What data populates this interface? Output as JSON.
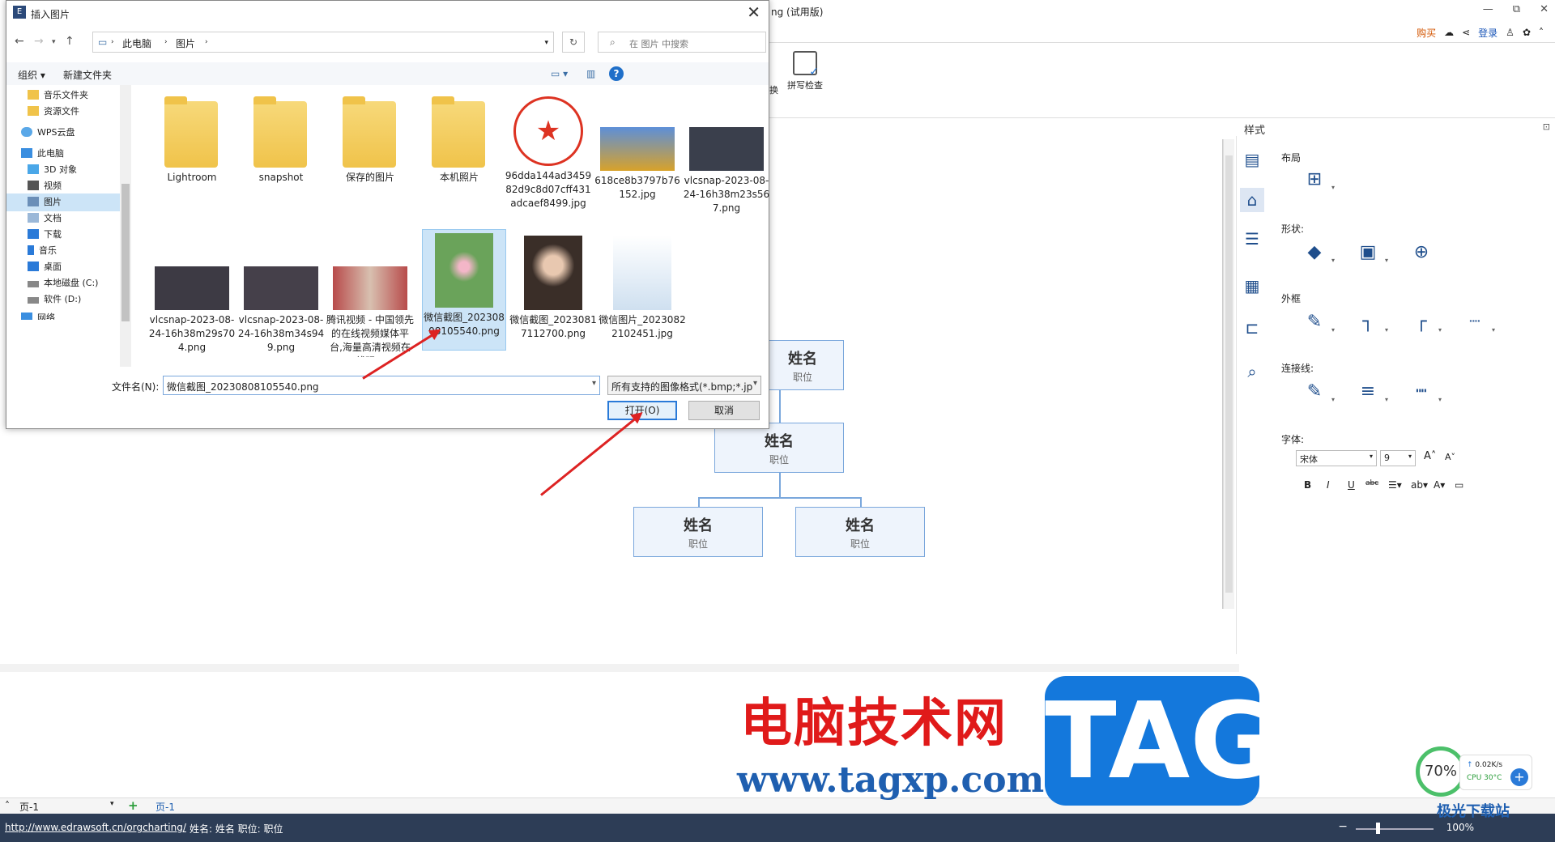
{
  "app": {
    "title": "ng (试用版)",
    "ctrl": [
      "—",
      "⧉",
      "✕"
    ],
    "tools": {
      "buy": "购买",
      "login": "登录"
    },
    "ribbon": {
      "prev_label": "换",
      "spellcheck_label": "拼写检查"
    }
  },
  "dialog": {
    "title": "插入图片",
    "close": "✕",
    "breadcrumb": [
      "此电脑",
      "图片"
    ],
    "search_placeholder": "在 图片 中搜索",
    "cmd": {
      "organize": "组织 ▾",
      "new_folder": "新建文件夹"
    },
    "nav_items": [
      {
        "label": "音乐文件夹",
        "icon": "folder-icon"
      },
      {
        "label": "资源文件",
        "icon": "folder-icon"
      },
      {
        "label": "WPS云盘",
        "icon": "cloud-icon"
      },
      {
        "label": "此电脑",
        "icon": "computer-icon"
      },
      {
        "label": "3D 对象",
        "icon": "cube-icon"
      },
      {
        "label": "视频",
        "icon": "video-icon"
      },
      {
        "label": "图片",
        "icon": "picture-icon"
      },
      {
        "label": "文档",
        "icon": "document-icon"
      },
      {
        "label": "下载",
        "icon": "download-icon"
      },
      {
        "label": "音乐",
        "icon": "music-icon"
      },
      {
        "label": "桌面",
        "icon": "desktop-icon"
      },
      {
        "label": "本地磁盘 (C:)",
        "icon": "disk-icon"
      },
      {
        "label": "软件 (D:)",
        "icon": "disk-icon"
      },
      {
        "label": "网络",
        "icon": "network-icon"
      }
    ],
    "files": [
      {
        "name": "Lightroom",
        "kind": "folder"
      },
      {
        "name": "snapshot",
        "kind": "folder"
      },
      {
        "name": "保存的图片",
        "kind": "folder"
      },
      {
        "name": "本机照片",
        "kind": "folder"
      },
      {
        "name": "96dda144ad345982d9c8d07cff431adcaef8499.jpg",
        "kind": "seal"
      },
      {
        "name": "618ce8b3797b76152.jpg",
        "kind": "photo",
        "color": "#d8a22a"
      },
      {
        "name": "vlcsnap-2023-08-24-16h38m23s567.png",
        "kind": "photo",
        "color": "#3a3f4c"
      },
      {
        "name": "vlcsnap-2023-08-24-16h38m29s704.png",
        "kind": "photo",
        "color": "#3d3a44"
      },
      {
        "name": "vlcsnap-2023-08-24-16h38m34s949.png",
        "kind": "photo",
        "color": "#45404a"
      },
      {
        "name": "腾讯视频 - 中国领先的在线视频媒体平台,海量高清视频在线观...",
        "kind": "photo",
        "color": "#b84b4b"
      },
      {
        "name": "微信截图_20230808105540.png",
        "kind": "tall",
        "color": "#6aa35a",
        "selected": true
      },
      {
        "name": "微信截图_20230817112700.png",
        "kind": "tall",
        "color": "#6b5a4a"
      },
      {
        "name": "微信图片_20230822102451.jpg",
        "kind": "tall",
        "color": "#cfe0f0"
      }
    ],
    "filename_label": "文件名(N):",
    "filename_value": "微信截图_20230808105540.png",
    "filetype_value": "所有支持的图像格式(*.bmp;*.jp",
    "open_label": "打开(O)",
    "cancel_label": "取消"
  },
  "chart": {
    "node_name": "姓名",
    "node_pos": "职位"
  },
  "panel": {
    "title": "样式",
    "layout": "布局",
    "shape": "形状:",
    "frame": "外框",
    "connector": "连接线:",
    "font": "字体:",
    "font_name": "宋体",
    "font_size": "9",
    "format_buttons": [
      "B",
      "I",
      "U",
      "abc"
    ]
  },
  "tabs": {
    "current": "页-1",
    "tab": "页-1"
  },
  "status": {
    "url": "http://www.edrawsoft.cn/orgcharting/",
    "info": "姓名: 姓名  职位: 职位",
    "zoom": "100%"
  },
  "watermark": {
    "cn": "电脑技术网",
    "url": "www.tagxp.com",
    "tag": "TAG",
    "site": "极光下载站"
  },
  "speed": {
    "percent": "70%",
    "rate": "0.02K/s",
    "cpu": "CPU 30°C"
  }
}
